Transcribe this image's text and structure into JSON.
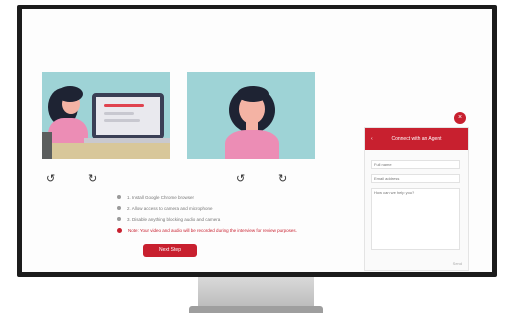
{
  "app": {
    "rotate_left_icon": "rotate-left",
    "rotate_right_icon": "rotate-right"
  },
  "checklist": [
    {
      "text": "1. Install Google Chrome browser",
      "state": "ok"
    },
    {
      "text": "2. Allow access to camera and microphone",
      "state": "ok"
    },
    {
      "text": "3. Disable anything blocking audio and camera",
      "state": "ok"
    },
    {
      "text": "Note: Your video and audio will be recorded during the interview for review purposes.",
      "state": "warning"
    }
  ],
  "primary_button": {
    "label": "Next Step"
  },
  "chat": {
    "close_label": "×",
    "back_label": "‹",
    "title": "Connect with an Agent",
    "name_placeholder": "Full name",
    "email_placeholder": "Email address",
    "message_placeholder": "How can we help you?",
    "send_label": "Send"
  },
  "colors": {
    "accent": "#c8202f",
    "teal": "#9ed3d6",
    "frame": "#1c1c1c"
  }
}
